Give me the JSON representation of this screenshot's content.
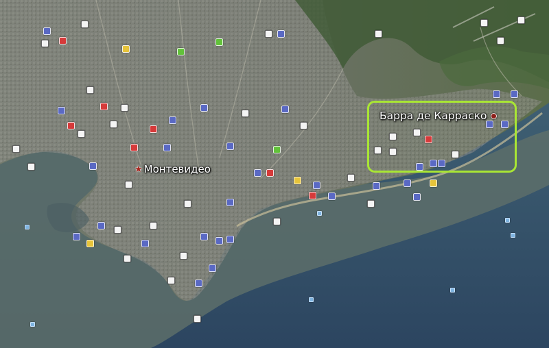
{
  "map": {
    "view": "satellite",
    "places": [
      {
        "id": "montevideo",
        "label": "Монтевидео",
        "marker": "star-icon"
      },
      {
        "id": "barra-de-carrasco",
        "label": "Барра де Карраско",
        "marker": "red-dot-icon",
        "highlighted": true
      }
    ],
    "highlight_color": "#a9e634",
    "water_color": "#2e4868",
    "land_color": "#6f7466"
  }
}
